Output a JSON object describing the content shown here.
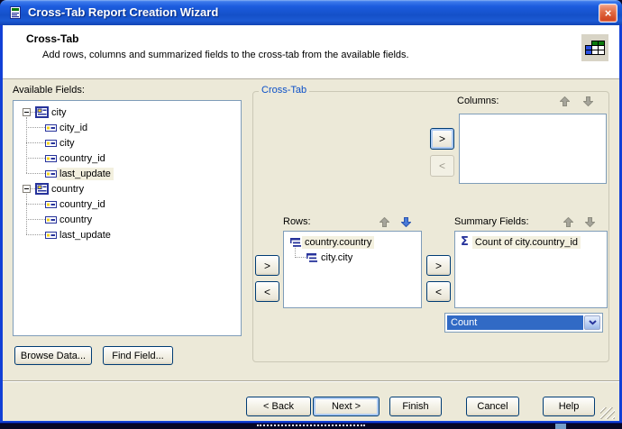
{
  "window": {
    "title": "Cross-Tab Report Creation Wizard"
  },
  "header": {
    "title": "Cross-Tab",
    "description": "Add rows, columns and summarized fields to the cross-tab from the available fields."
  },
  "available_fields": {
    "label": "Available Fields:",
    "tree": [
      {
        "label": "city",
        "type": "table",
        "expanded": true,
        "children": [
          {
            "label": "city_id",
            "type": "field"
          },
          {
            "label": "city",
            "type": "field"
          },
          {
            "label": "country_id",
            "type": "field"
          },
          {
            "label": "last_update",
            "type": "field",
            "selected": true
          }
        ]
      },
      {
        "label": "country",
        "type": "table",
        "expanded": true,
        "children": [
          {
            "label": "country_id",
            "type": "field"
          },
          {
            "label": "country",
            "type": "field"
          },
          {
            "label": "last_update",
            "type": "field"
          }
        ]
      }
    ],
    "browse_button": "Browse Data...",
    "find_button": "Find Field..."
  },
  "crosstab": {
    "label": "Cross-Tab",
    "columns": {
      "label": "Columns:",
      "items": [],
      "up_enabled": false,
      "down_enabled": false,
      "add_enabled": true,
      "remove_enabled": false
    },
    "rows": {
      "label": "Rows:",
      "items": [
        {
          "label": "country.country",
          "selected": true
        },
        {
          "label": "city.city",
          "selected": false
        }
      ],
      "up_enabled": false,
      "down_enabled": true,
      "add_enabled": true,
      "remove_enabled": true
    },
    "summary": {
      "label": "Summary Fields:",
      "items": [
        {
          "label": "Count of city.country_id",
          "selected": true
        }
      ],
      "up_enabled": false,
      "down_enabled": false,
      "add_enabled": true,
      "remove_enabled": true,
      "operation": "Count"
    }
  },
  "footer": {
    "back_label": "< Back",
    "next_label": "Next >",
    "finish_label": "Finish",
    "cancel_label": "Cancel",
    "help_label": "Help"
  },
  "icons": {
    "close": "×",
    "sigma": "Σ",
    "move_right": ">",
    "move_left": "<"
  },
  "colors": {
    "window-border": "#1240D6",
    "dialog-bg": "#ECE9D8",
    "group-label": "#0B50C8",
    "listbox-border": "#7F9DB9",
    "selection-inactive": "#F3F0DF",
    "selection-blue": "#316AC5",
    "btn-border": "#003C74",
    "arrow-blue": "#4A7BD8",
    "arrow-gray": "#A5A49A",
    "icon-navy": "#27339B",
    "icon-yellow": "#F4D31C",
    "icon-green": "#0B7A0B",
    "icon-blue": "#2B50E0",
    "taskbar": "#070726"
  }
}
